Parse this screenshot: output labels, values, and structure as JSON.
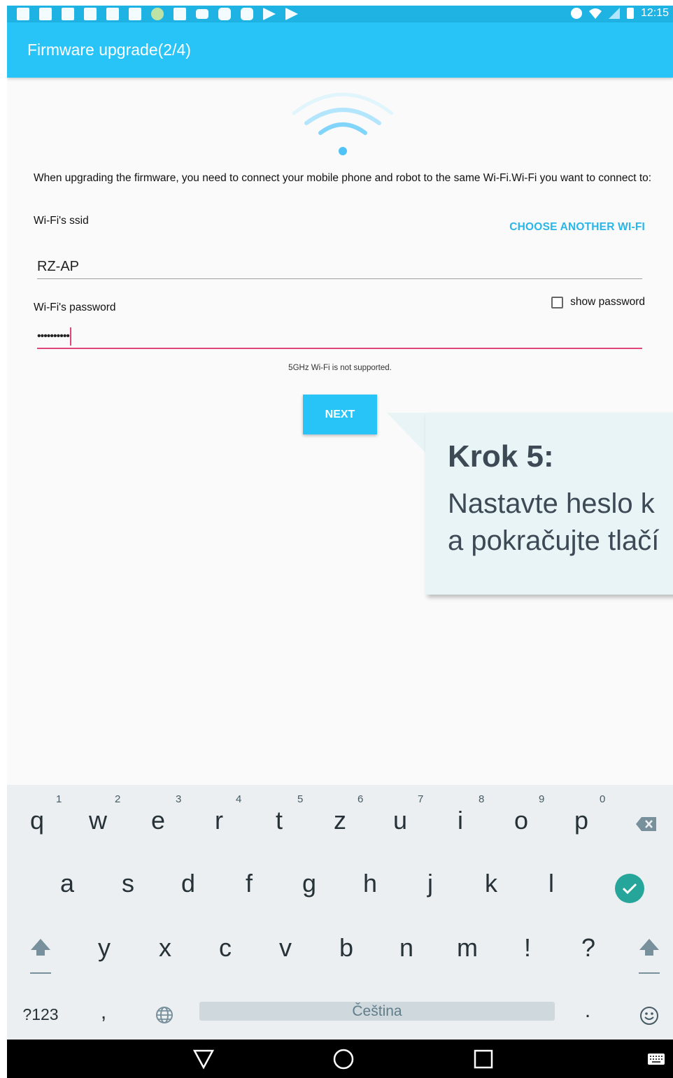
{
  "status_bar": {
    "time": "12:15"
  },
  "app_bar": {
    "title": "Firmware upgrade(2/4)"
  },
  "intro_text": "When upgrading the firmware, you need to connect your mobile phone and robot to the same Wi-Fi.Wi-Fi you want to connect to:",
  "ssid": {
    "label": "Wi-Fi's ssid",
    "value": "RZ-AP",
    "choose_link": "CHOOSE ANOTHER WI-FI"
  },
  "password": {
    "label": "Wi-Fi's password",
    "value": "••••••••••",
    "show_password_label": "show password",
    "show_password_checked": false
  },
  "note": "5GHz Wi-Fi is not supported.",
  "next_button": "NEXT",
  "callout": {
    "title": "Krok 5:",
    "line1": "Nastavte heslo k",
    "line2": "a pokračujte tlačí"
  },
  "keyboard": {
    "row1": [
      "q",
      "w",
      "e",
      "r",
      "t",
      "z",
      "u",
      "i",
      "o",
      "p"
    ],
    "row1_hints": [
      "1",
      "2",
      "3",
      "4",
      "5",
      "6",
      "7",
      "8",
      "9",
      "0"
    ],
    "row2": [
      "a",
      "s",
      "d",
      "f",
      "g",
      "h",
      "j",
      "k",
      "l"
    ],
    "row3": [
      "y",
      "x",
      "c",
      "v",
      "b",
      "n",
      "m",
      "!",
      "?"
    ],
    "symbols_key": "?123",
    "comma": ",",
    "period": ".",
    "space_label": "Čeština"
  },
  "colors": {
    "accent": "#29c4f7",
    "password_underline": "#e0457b",
    "callout_bg": "#e8f4f6",
    "enter_key": "#26a69a"
  }
}
